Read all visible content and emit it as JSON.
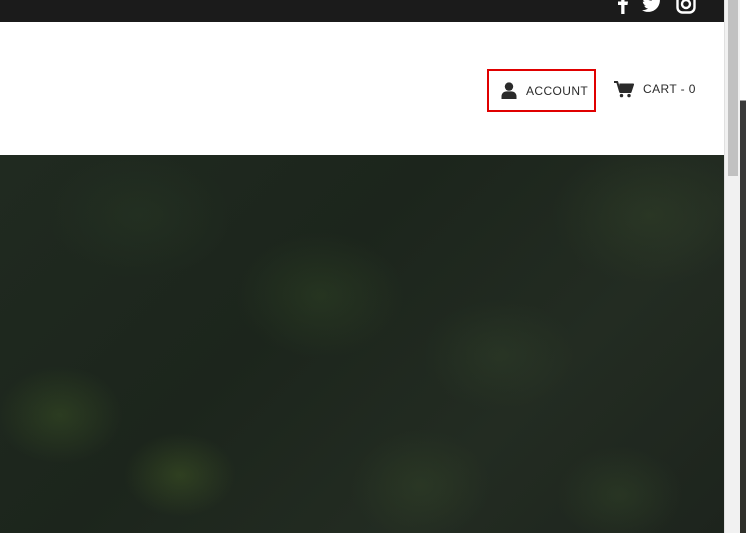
{
  "top_bar": {
    "social_icons": [
      "facebook-icon",
      "twitter-icon",
      "instagram-icon"
    ]
  },
  "header": {
    "account_label": "ACCOUNT",
    "cart_label": "CART - 0",
    "account_icon": "user-icon",
    "cart_icon": "cart-icon",
    "highlight_color": "#e00000"
  }
}
